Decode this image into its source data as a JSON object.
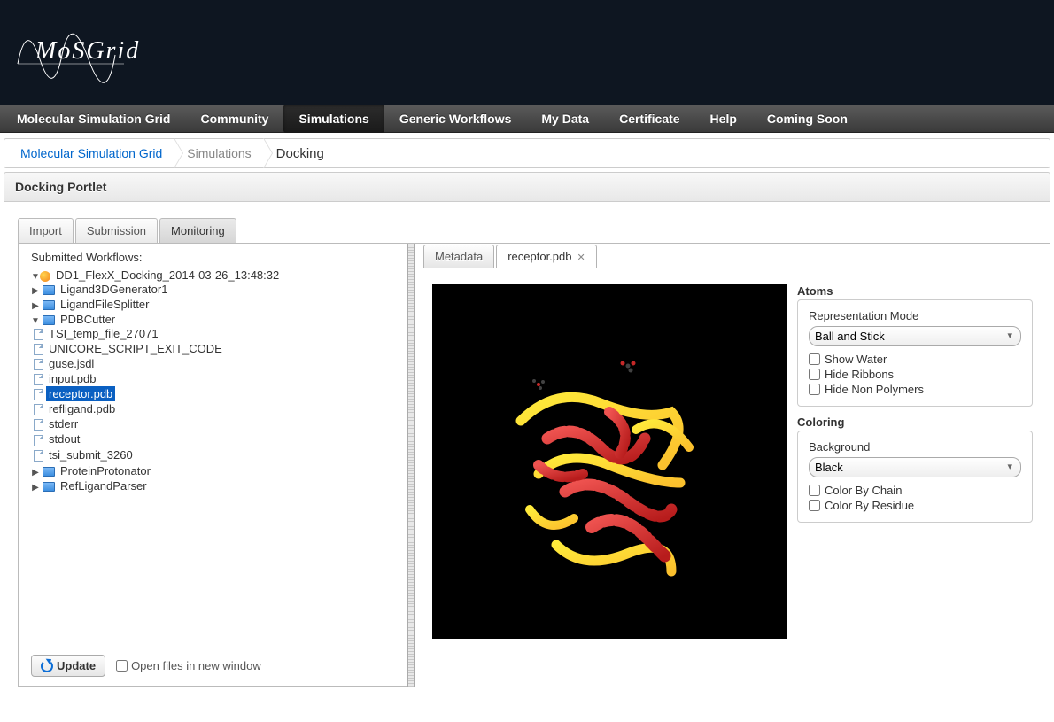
{
  "logo_text": "MoSGrid",
  "nav": {
    "items": [
      "Molecular Simulation Grid",
      "Community",
      "Simulations",
      "Generic Workflows",
      "My Data",
      "Certificate",
      "Help",
      "Coming Soon"
    ],
    "active_index": 2
  },
  "breadcrumb": {
    "root": "Molecular Simulation Grid",
    "mid": "Simulations",
    "current": "Docking"
  },
  "portlet_title": "Docking Portlet",
  "outer_tabs": {
    "items": [
      "Import",
      "Submission",
      "Monitoring"
    ],
    "active_index": 2
  },
  "tree": {
    "title": "Submitted Workflows:",
    "root": {
      "label": "DD1_FlexX_Docking_2014-03-26_13:48:32"
    },
    "ligand3d": "Ligand3DGenerator1",
    "ligandsplit": "LigandFileSplitter",
    "pdbcutter": {
      "label": "PDBCutter",
      "files": [
        "TSI_temp_file_27071",
        "UNICORE_SCRIPT_EXIT_CODE",
        "guse.jsdl",
        "input.pdb",
        "receptor.pdb",
        "refligand.pdb",
        "stderr",
        "stdout",
        "tsi_submit_3260"
      ],
      "selected_index": 4
    },
    "proteinprot": "ProteinProtonator",
    "refligparser": "RefLigandParser"
  },
  "footer": {
    "update": "Update",
    "open_in_new": "Open files in new window"
  },
  "inner_tabs": {
    "items": [
      "Metadata",
      "receptor.pdb"
    ],
    "active_index": 1
  },
  "atoms_panel": {
    "title": "Atoms",
    "rep_label": "Representation Mode",
    "rep_value": "Ball and Stick",
    "show_water": "Show Water",
    "hide_ribbons": "Hide Ribbons",
    "hide_nonpoly": "Hide Non Polymers"
  },
  "coloring_panel": {
    "title": "Coloring",
    "bg_label": "Background",
    "bg_value": "Black",
    "by_chain": "Color By Chain",
    "by_residue": "Color By Residue"
  }
}
